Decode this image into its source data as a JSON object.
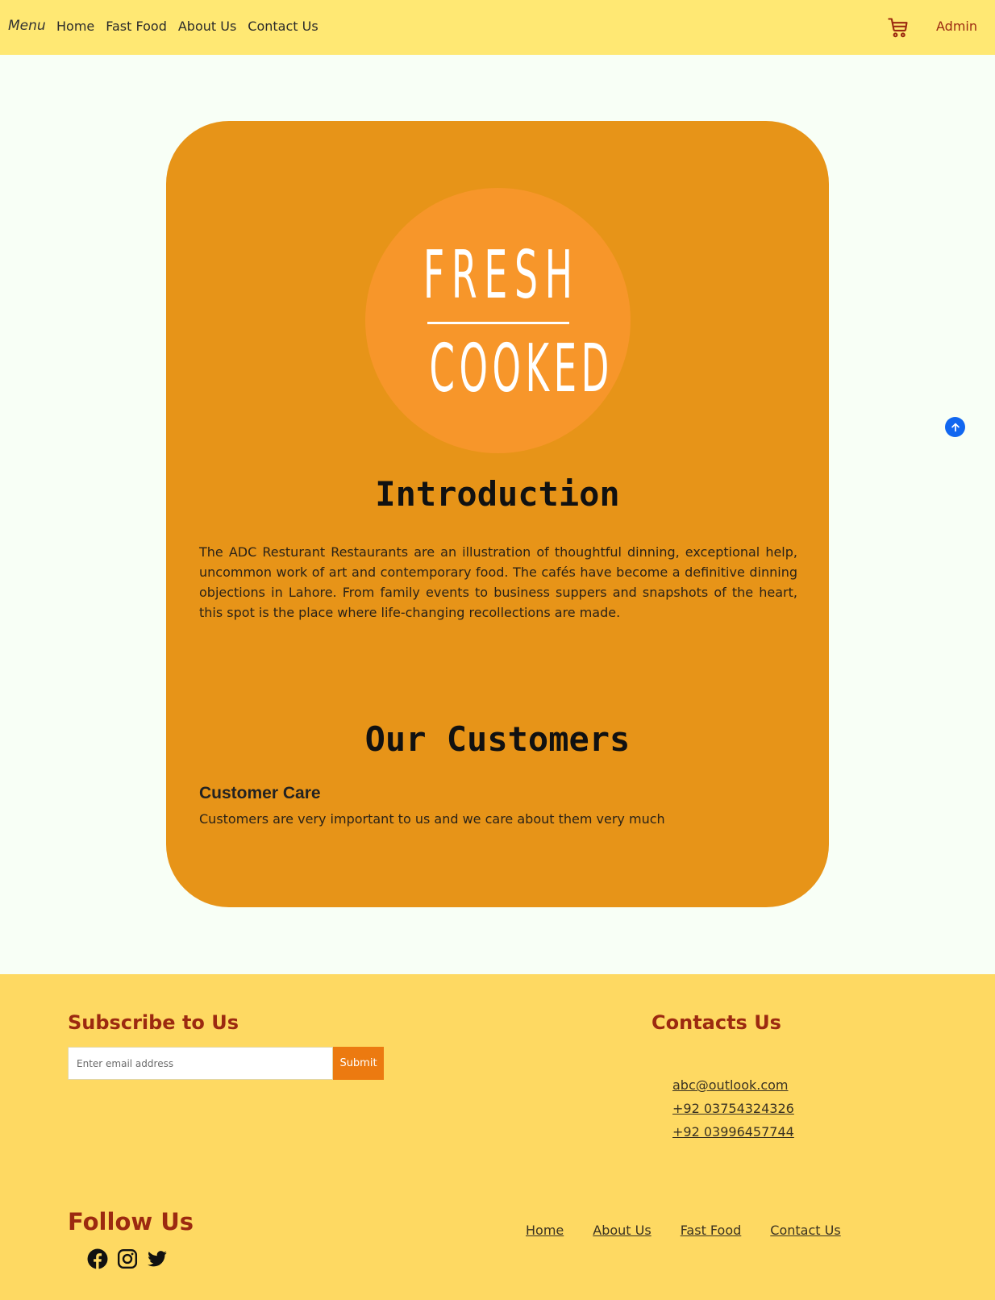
{
  "navbar": {
    "brand": "Menu",
    "links": [
      "Home",
      "Fast Food",
      "About Us",
      "Contact Us"
    ],
    "cart_icon": "cart-icon",
    "admin_label": "Admin"
  },
  "card": {
    "logo": {
      "line1": "FRESH",
      "line2": "COOKED"
    },
    "intro_heading": "Introduction",
    "intro_text": "The ADC Resturant Restaurants are an illustration of thoughtful dinning, exceptional help, uncommon work of art and contemporary food. The cafés have become a definitive dinning objections in Lahore. From family events to business suppers and snapshots of the heart, this spot is the place where life-changing recollections are made.",
    "customers_heading": "Our Customers",
    "care_title": "Customer Care",
    "care_text": "Customers are very important to us and we care about them very much"
  },
  "scroll_top_icon": "arrow-up-icon",
  "footer": {
    "subscribe_heading": "Subscribe to Us",
    "email_placeholder": "Enter email address",
    "email_value": "",
    "submit_label": "Submit",
    "contacts_heading": "Contacts Us",
    "contacts": [
      "abc@outlook.com",
      "+92 03754324326",
      "+92 03996457744"
    ],
    "follow_heading": "Follow Us",
    "social_icons": [
      "facebook-icon",
      "instagram-icon",
      "twitter-icon"
    ],
    "links": [
      "Home",
      "About Us",
      "Fast Food",
      "Contact Us"
    ]
  },
  "colors": {
    "navbar_bg": "#ffe873",
    "page_bg": "#f8fff6",
    "card_bg": "#e79418",
    "logo_circle": "#f7962a",
    "footer_bg": "#fed962",
    "accent_red": "#9c2a10",
    "submit_orange": "#ec7a10",
    "scroll_blue": "#1167f0"
  }
}
